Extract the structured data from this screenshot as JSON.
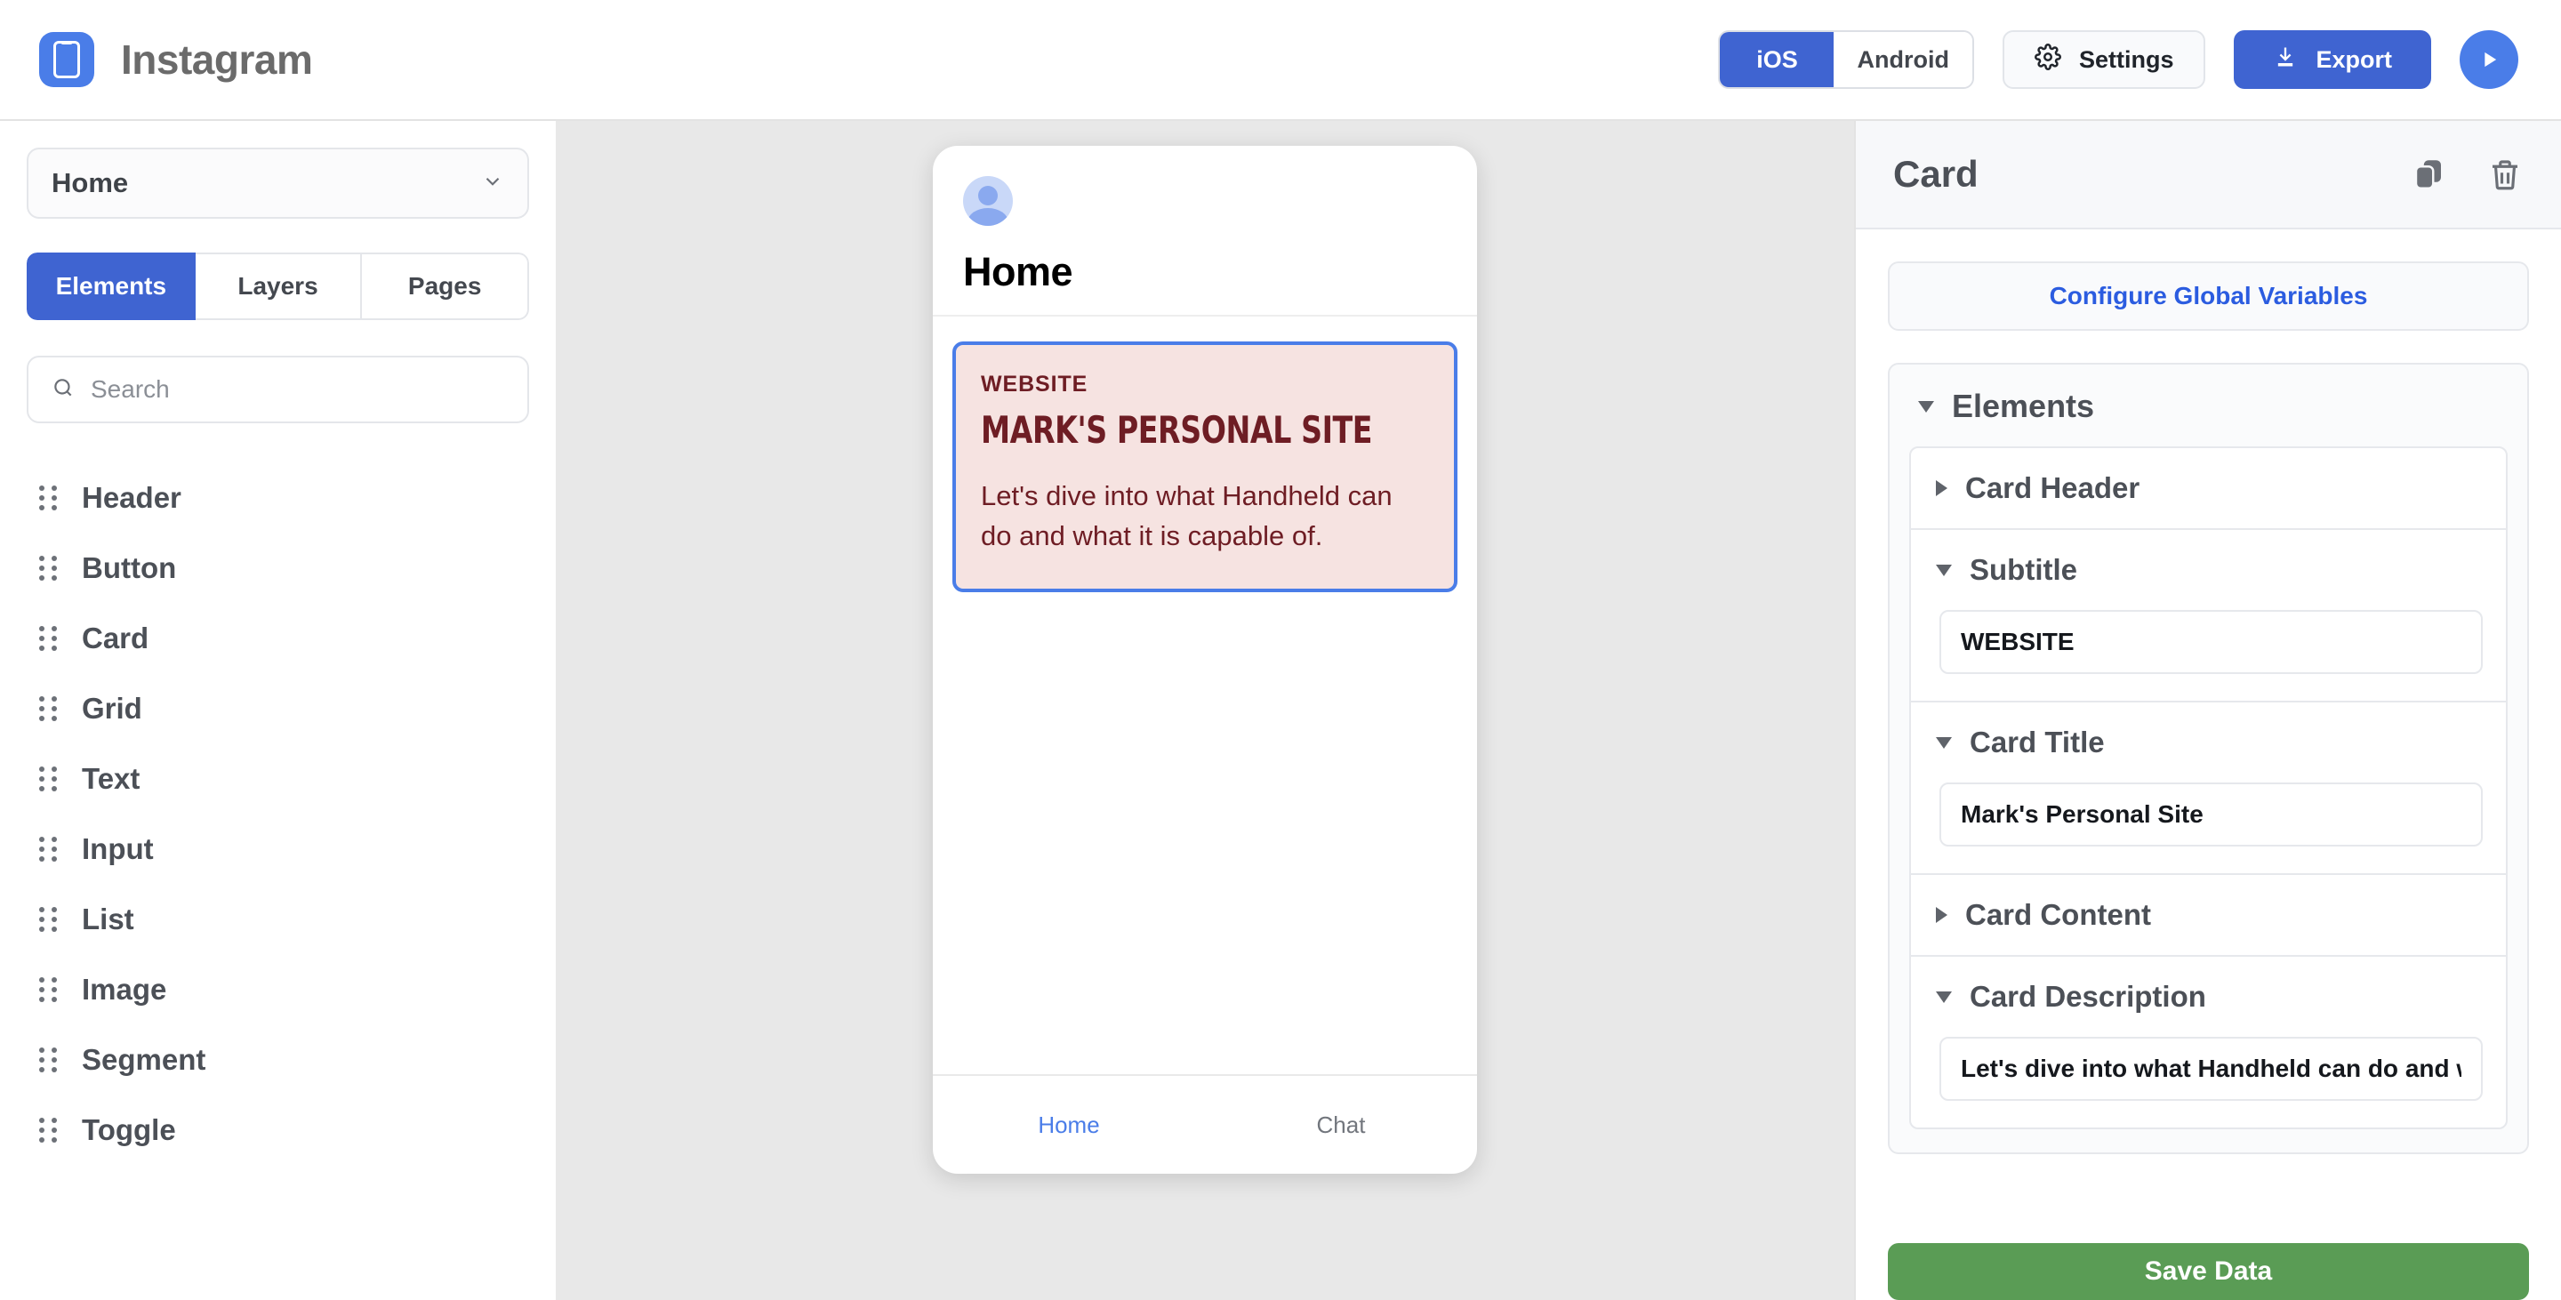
{
  "topbar": {
    "logo_icon": "phone-app-logo-icon",
    "app_title": "Instagram",
    "platform_segment": {
      "options": [
        "iOS",
        "Android"
      ],
      "selected": "iOS"
    },
    "settings_label": "Settings",
    "settings_icon": "gear-icon",
    "export_label": "Export",
    "export_icon": "download-icon",
    "play_icon": "play-icon"
  },
  "sidebar": {
    "page_select": {
      "value": "Home",
      "chevron_icon": "chevron-down-icon"
    },
    "tabs": [
      {
        "label": "Elements",
        "active": true
      },
      {
        "label": "Layers",
        "active": false
      },
      {
        "label": "Pages",
        "active": false
      }
    ],
    "search": {
      "placeholder": "Search",
      "value": "",
      "icon": "search-icon"
    },
    "elements": [
      {
        "label": "Header"
      },
      {
        "label": "Button"
      },
      {
        "label": "Card"
      },
      {
        "label": "Grid"
      },
      {
        "label": "Text"
      },
      {
        "label": "Input"
      },
      {
        "label": "List"
      },
      {
        "label": "Image"
      },
      {
        "label": "Segment"
      },
      {
        "label": "Toggle"
      }
    ]
  },
  "canvas": {
    "phone_preview": {
      "avatar_icon": "user-avatar-icon",
      "page_title": "Home",
      "card": {
        "subtitle": "WEBSITE",
        "title": "MARK'S PERSONAL SITE",
        "description": "Let's dive into what Handheld can do and what it is capable of.",
        "background_color": "#f6e3e1",
        "text_color": "#6e1d24",
        "selection_color": "#4a7de8"
      },
      "tabbar": [
        {
          "label": "Home",
          "active": true
        },
        {
          "label": "Chat",
          "active": false
        }
      ]
    }
  },
  "inspector": {
    "title": "Card",
    "duplicate_icon": "copy-icon",
    "delete_icon": "trash-icon",
    "globals_button": "Configure Global Variables",
    "root_section": {
      "label": "Elements",
      "expanded": true
    },
    "sections": [
      {
        "label": "Card Header",
        "expanded": false,
        "value": null
      },
      {
        "label": "Subtitle",
        "expanded": true,
        "value": "WEBSITE"
      },
      {
        "label": "Card Title",
        "expanded": true,
        "value": "Mark's Personal Site"
      },
      {
        "label": "Card Content",
        "expanded": false,
        "value": null
      },
      {
        "label": "Card Description",
        "expanded": true,
        "value": "Let's dive into what Handheld can do and what it is capable of."
      }
    ],
    "save_button": "Save Data"
  },
  "colors": {
    "accent_blue": "#3f64d1",
    "play_blue": "#4a7de8",
    "save_green": "#5a9c55",
    "canvas_gray": "#e8e8e8",
    "link_blue": "#2b5ce0"
  }
}
